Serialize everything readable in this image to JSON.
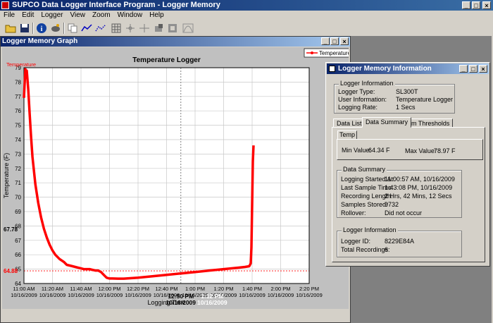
{
  "app": {
    "title": "SUPCO Data Logger Interface Program - Logger Memory",
    "menu": [
      "File",
      "Edit",
      "Logger",
      "View",
      "Zoom",
      "Window",
      "Help"
    ],
    "window_controls": [
      "_",
      "□",
      "×"
    ]
  },
  "toolbar": {
    "icons": [
      "open-folder-icon",
      "save-icon",
      "info-icon",
      "satellite-icon",
      "copy-icon",
      "line-graph-icon",
      "dotted-graph-icon",
      "grid-icon",
      "cursor-icon",
      "crosshair-icon",
      "fill-icon",
      "area-icon"
    ]
  },
  "graph_window": {
    "title": "Logger Memory Graph",
    "controls": [
      "_",
      "□",
      "×"
    ]
  },
  "chart_data": {
    "type": "line",
    "title": "Temperature Logger",
    "xlabel": "Logging Time",
    "ylabel": "Temperature (F)",
    "series_label_top": "Temperature",
    "legend": "Temperature",
    "ylim": [
      64,
      79
    ],
    "yticks": [
      64,
      65,
      66,
      67,
      68,
      69,
      70,
      71,
      72,
      73,
      74,
      75,
      76,
      77,
      78,
      79
    ],
    "xticks": [
      {
        "t": 0,
        "time": "11:00 AM",
        "date": "10/16/2009"
      },
      {
        "t": 20,
        "time": "11:20 AM",
        "date": "10/16/2009"
      },
      {
        "t": 40,
        "time": "11:40 AM",
        "date": "10/16/2009"
      },
      {
        "t": 60,
        "time": "12:00 PM",
        "date": "10/16/2009"
      },
      {
        "t": 80,
        "time": "12:20 PM",
        "date": "10/16/2009"
      },
      {
        "t": 100,
        "time": "12:40 PM",
        "date": "10/16/2009"
      },
      {
        "t": 120,
        "time": "1:00 PM",
        "date": "10/16/2009"
      },
      {
        "t": 140,
        "time": "1:20 PM",
        "date": "10/16/2009"
      },
      {
        "t": 160,
        "time": "1:40 PM",
        "date": "10/16/2009"
      },
      {
        "t": 180,
        "time": "2:00 PM",
        "date": "10/16/2009"
      },
      {
        "t": 200,
        "time": "2:20 PM",
        "date": "10/16/2009"
      }
    ],
    "xlim": [
      0,
      200
    ],
    "cursor_left": {
      "t": 110,
      "time": "12:50 PM",
      "date": "10/16/2009"
    },
    "cursor_right": {
      "t": 132,
      "time": "1:12 PM",
      "date": "10/16/2009"
    },
    "marker_y": {
      "value": 67.78,
      "label": "67.78"
    },
    "marker_red": {
      "value": 64.88,
      "label": "64.88"
    },
    "x": [
      0,
      1,
      1.5,
      2,
      3,
      4,
      5,
      6,
      8,
      10,
      12,
      14,
      16,
      18,
      20,
      22,
      25,
      28,
      30,
      34,
      38,
      42,
      46,
      50,
      52,
      54,
      56,
      58,
      60,
      62,
      66,
      70,
      80,
      90,
      100,
      110,
      120,
      130,
      140,
      150,
      155,
      158,
      159,
      159.5,
      160,
      160.5,
      161
    ],
    "y": [
      76.9,
      78.9,
      78.6,
      78.8,
      77.5,
      75.8,
      74.2,
      72.8,
      70.9,
      69.6,
      68.6,
      67.8,
      67.2,
      66.7,
      66.3,
      66.0,
      65.7,
      65.5,
      65.3,
      65.2,
      65.1,
      65.0,
      65.0,
      64.9,
      64.9,
      64.8,
      64.6,
      64.4,
      64.35,
      64.35,
      64.34,
      64.34,
      64.4,
      64.5,
      64.6,
      64.7,
      64.8,
      64.9,
      65.0,
      65.1,
      65.15,
      65.2,
      65.4,
      66.5,
      69.5,
      72.5,
      73.6
    ]
  },
  "info_window": {
    "title": "Logger Memory Information",
    "controls": [
      "_",
      "□",
      "×"
    ],
    "logger_info": {
      "group": "Logger Information",
      "rows": [
        {
          "k": "Logger Type:",
          "v": "SL300T"
        },
        {
          "k": "User Information:",
          "v": "Temperature Logger"
        },
        {
          "k": "Logging Rate:",
          "v": "1 Secs"
        }
      ]
    },
    "tabs": [
      "Data Listing",
      "Data Summary",
      "Alarm Thresholds"
    ],
    "temp_group": "Temp",
    "min_label": "Min Value:",
    "min_value": "64.34 F",
    "max_label": "Max Value:",
    "max_value": "78.97 F",
    "summary": {
      "group": "Data Summary",
      "rows": [
        {
          "k": "Logging Started At:",
          "v": "11:00:57 AM, 10/16/2009"
        },
        {
          "k": "Last Sample Time:",
          "v": "1:43:08 PM, 10/16/2009"
        },
        {
          "k": "Recording Length:",
          "v": "2 Hrs, 42 Mins, 12 Secs"
        },
        {
          "k": "Samples Stored:",
          "v": "9732"
        },
        {
          "k": "Rollover:",
          "v": "Did not occur"
        }
      ]
    },
    "logger_id": {
      "group": "Logger Information",
      "rows": [
        {
          "k": "Logger ID:",
          "v": "8229E84A"
        },
        {
          "k": "Total Recordings:",
          "v": "6"
        }
      ]
    }
  },
  "colors": {
    "series": "#ff0000",
    "titlebar": "#0a246a"
  }
}
